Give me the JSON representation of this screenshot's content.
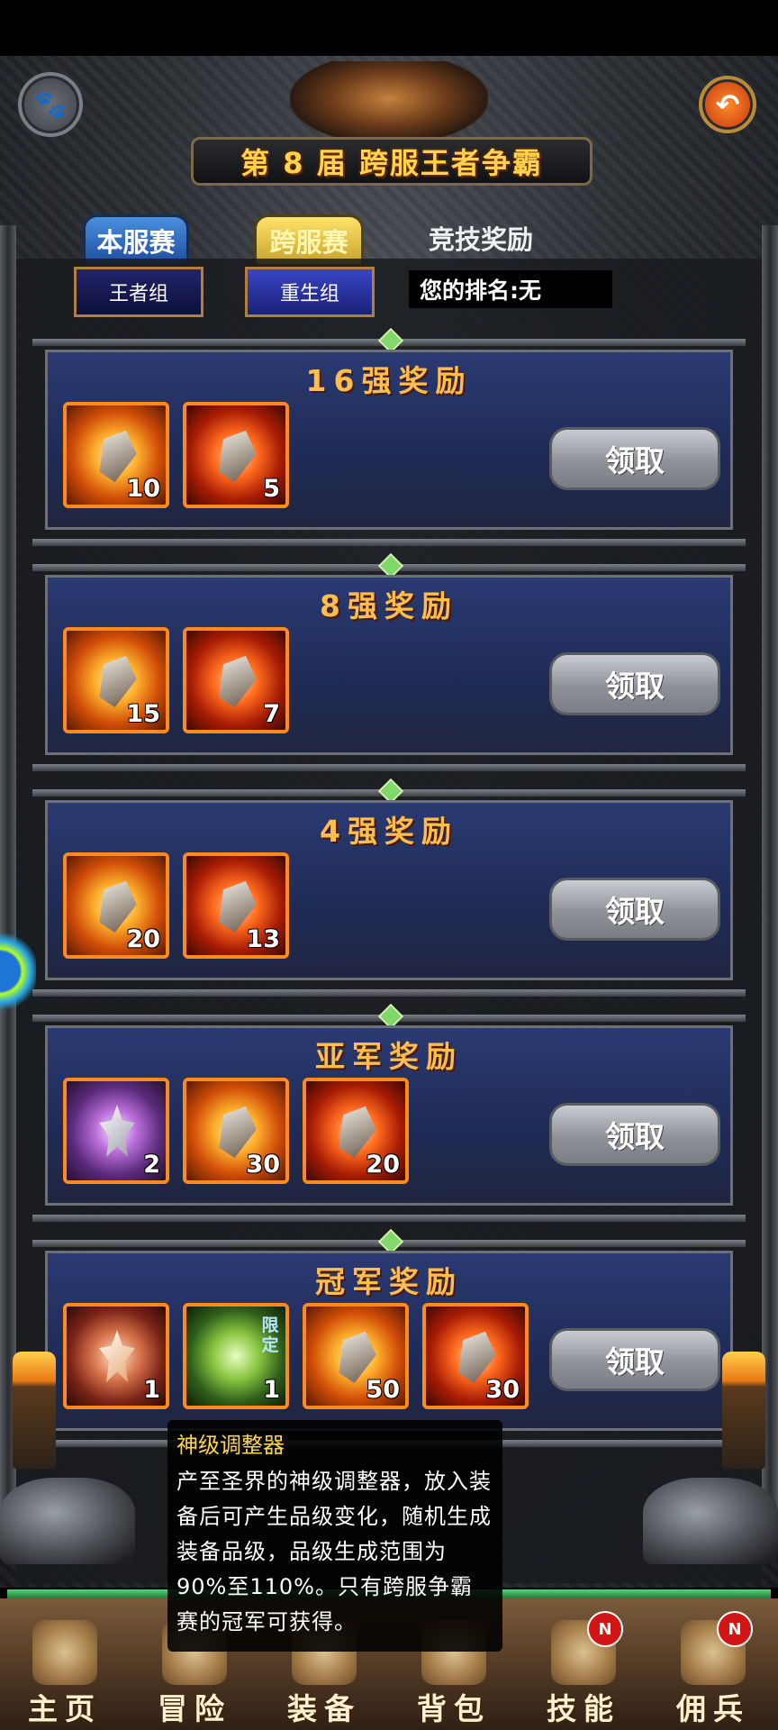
{
  "header": {
    "title": "第 8 届 跨服王者争霸"
  },
  "tabs": [
    "本服赛",
    "跨服赛",
    "竞技奖励"
  ],
  "groups": {
    "king": "王者组",
    "reborn": "重生组"
  },
  "rank_text": "您的排名:无",
  "sections": [
    {
      "title": "16强奖励",
      "claim": "领取",
      "items": [
        {
          "qty": "10"
        },
        {
          "qty": "5"
        }
      ]
    },
    {
      "title": "8强奖励",
      "claim": "领取",
      "items": [
        {
          "qty": "15"
        },
        {
          "qty": "7"
        }
      ]
    },
    {
      "title": "4强奖励",
      "claim": "领取",
      "items": [
        {
          "qty": "20"
        },
        {
          "qty": "13"
        }
      ]
    },
    {
      "title": "亚军奖励",
      "claim": "领取",
      "items": [
        {
          "qty": "2"
        },
        {
          "qty": "30"
        },
        {
          "qty": "20"
        }
      ]
    },
    {
      "title": "冠军奖励",
      "claim": "领取",
      "items": [
        {
          "qty": "1"
        },
        {
          "qty": "1",
          "tag": "限定"
        },
        {
          "qty": "50"
        },
        {
          "qty": "30"
        }
      ]
    }
  ],
  "tooltip": {
    "title": "神级调整器",
    "body": "产至圣界的神级调整器，放入装备后可产生品级变化，随机生成装备品级，品级生成范围为90%至110%。只有跨服争霸赛的冠军可获得。"
  },
  "nav": [
    {
      "label": "主页",
      "icon": "castle-icon"
    },
    {
      "label": "冒险",
      "icon": "helmet-icon"
    },
    {
      "label": "装备",
      "icon": "armor-icon"
    },
    {
      "label": "背包",
      "icon": "bag-icon"
    },
    {
      "label": "技能",
      "icon": "scroll-icon",
      "badge": "N"
    },
    {
      "label": "佣兵",
      "icon": "knight-icon",
      "badge": "N"
    }
  ]
}
